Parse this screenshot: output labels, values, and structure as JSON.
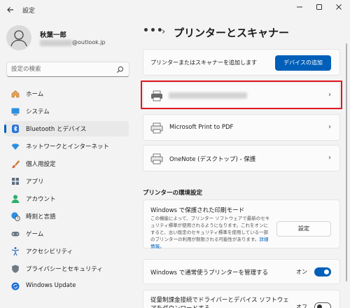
{
  "window": {
    "title": "設定",
    "back_icon": "back-arrow-icon",
    "controls": [
      "minimize-icon",
      "maximize-icon",
      "close-icon"
    ]
  },
  "profile": {
    "name": "秋葉一郎",
    "email_suffix": "@outlook.jp"
  },
  "search": {
    "placeholder": "設定の検索"
  },
  "sidebar": {
    "items": [
      {
        "label": "ホーム",
        "icon": "home-icon"
      },
      {
        "label": "システム",
        "icon": "system-icon"
      },
      {
        "label": "Bluetooth とデバイス",
        "icon": "bluetooth-icon",
        "active": true
      },
      {
        "label": "ネットワークとインターネット",
        "icon": "wifi-icon"
      },
      {
        "label": "個人用設定",
        "icon": "brush-icon"
      },
      {
        "label": "アプリ",
        "icon": "apps-icon"
      },
      {
        "label": "アカウント",
        "icon": "account-icon"
      },
      {
        "label": "時刻と言語",
        "icon": "globe-clock-icon"
      },
      {
        "label": "ゲーム",
        "icon": "gamepad-icon"
      },
      {
        "label": "アクセシビリティ",
        "icon": "accessibility-icon"
      },
      {
        "label": "プライバシーとセキュリティ",
        "icon": "shield-icon"
      },
      {
        "label": "Windows Update",
        "icon": "update-icon"
      }
    ]
  },
  "header": {
    "more": "•••",
    "separator": "›",
    "title": "プリンターとスキャナー"
  },
  "add_device": {
    "label": "プリンターまたはスキャナーを追加します",
    "button": "デバイスの追加"
  },
  "printers": [
    {
      "name": "",
      "blurred": true
    },
    {
      "name": "Microsoft Print to PDF"
    },
    {
      "name": "OneNote (デスクトップ) - 保護"
    }
  ],
  "preferences": {
    "section_title": "プリンターの環境設定",
    "protected_mode": {
      "title": "Windows で保護された印刷モード",
      "description": "この機能によって、プリンター ソフトウェアで最新のセキュリティ標準が使用されるようになります。これをオンにすると、古い既定のセキュリティ標準を使用している一部のプリンターの利用が制限される可能性があります。",
      "link": "詳細情報。",
      "button": "設定"
    },
    "manage_default": {
      "label": "Windows で通常使うプリンターを管理する",
      "state_label": "オン",
      "on": true
    },
    "metered": {
      "label": "従量制課金接続でドライバーとデバイス ソフトウェアをダウンロードする",
      "state_label": "オフ",
      "on": false
    }
  },
  "colors": {
    "accent": "#005fb8",
    "highlight": "#e0161f"
  }
}
